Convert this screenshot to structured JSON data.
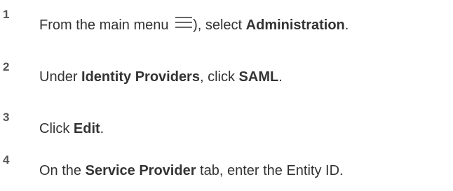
{
  "steps": [
    {
      "number": "1",
      "text_before": "From the main menu ",
      "icon": "hamburger-menu-icon",
      "text_mid": "), select ",
      "bold": "Administration",
      "text_after": "."
    },
    {
      "number": "2",
      "text_before": "Under ",
      "bold1": "Identity Providers",
      "text_mid": ", click ",
      "bold2": "SAML",
      "text_after": "."
    },
    {
      "number": "3",
      "text_before": "Click ",
      "bold": "Edit",
      "text_after": "."
    },
    {
      "number": "4",
      "text_before": "On the ",
      "bold": "Service Provider",
      "text_after": " tab, enter the Entity ID."
    }
  ]
}
